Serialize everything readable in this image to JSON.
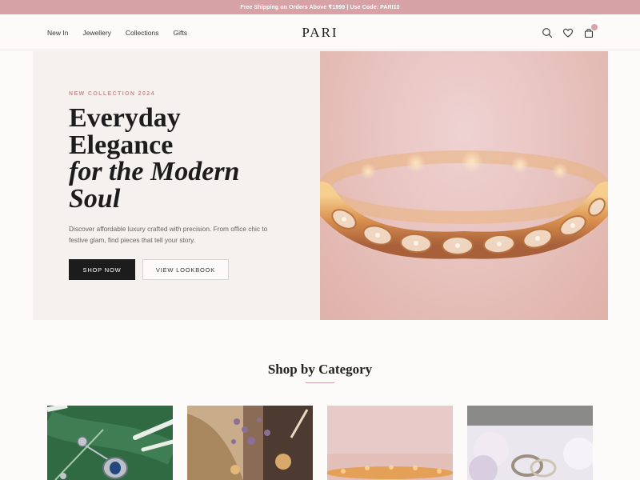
{
  "announcement": "Free Shipping on Orders Above ₹1999 | Use Code: PARI10",
  "header": {
    "nav": [
      "New In",
      "Jewellery",
      "Collections",
      "Gifts"
    ],
    "logo": "PARI",
    "icons": [
      "search-icon",
      "heart-icon",
      "bag-icon"
    ]
  },
  "hero": {
    "eyebrow": "NEW COLLECTION 2024",
    "headline_line1": "Everyday",
    "headline_line2": "Elegance",
    "headline_line3": "for the Modern",
    "headline_line4": "Soul",
    "description": "Discover affordable luxury crafted with precision. From office chic to festive glam, find pieces that tell your story.",
    "primary_button": "SHOP NOW",
    "secondary_button": "VIEW LOOKBOOK",
    "image": "rose-gold bracelet photo"
  },
  "categories": {
    "title": "Shop by Category",
    "items": [
      "pendant photo",
      "earrings photo",
      "bracelet photo",
      "rings photo"
    ]
  },
  "colors": {
    "accent": "#d7a2a6",
    "dark": "#1c1c1c",
    "background": "#fdfbf9",
    "hero_bg": "#f4f1ee"
  }
}
